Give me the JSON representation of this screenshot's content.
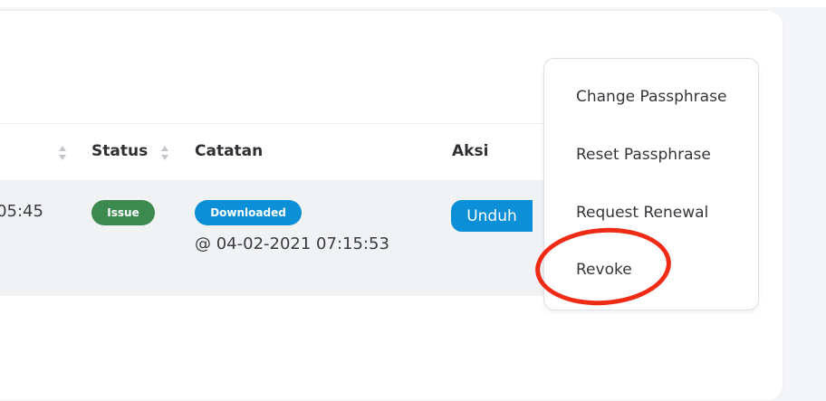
{
  "table": {
    "headers": {
      "status": "Status",
      "catatan": "Catatan",
      "aksi": "Aksi"
    },
    "row": {
      "time_partial": ":05:45",
      "status_badge": "Issue",
      "catatan_badge": "Downloaded",
      "catatan_time": "@ 04-02-2021 07:15:53",
      "action_button": "Unduh"
    }
  },
  "dropdown_menu": {
    "items": [
      "Change Passphrase",
      "Reset Passphrase",
      "Request Renewal",
      "Revoke"
    ]
  },
  "colors": {
    "status_badge": "#3d8a51",
    "catatan_badge": "#0b8fd6",
    "action_button": "#0b8fd6",
    "annotation_circle": "#ef2b16"
  },
  "icons": {
    "sort": "sort-icon"
  }
}
